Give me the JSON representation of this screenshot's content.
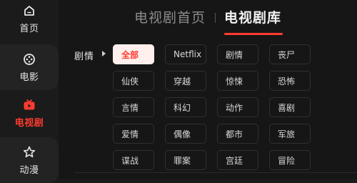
{
  "sidebar": {
    "items": [
      {
        "label": "首页",
        "icon": "home-icon"
      },
      {
        "label": "电影",
        "icon": "film-reel-icon"
      },
      {
        "label": "电视剧",
        "icon": "tv-icon",
        "active": true
      },
      {
        "label": "动漫",
        "icon": "star-icon"
      }
    ]
  },
  "tabs": [
    {
      "label": "电视剧首页"
    },
    {
      "label": "电视剧库",
      "active": true
    }
  ],
  "filter": {
    "label": "剧情",
    "options": [
      "全部",
      "Netflix",
      "剧情",
      "丧尸",
      "仙侠",
      "穿越",
      "惊悚",
      "恐怖",
      "言情",
      "科幻",
      "动作",
      "喜剧",
      "爱情",
      "偶像",
      "都市",
      "军旅",
      "谍战",
      "罪案",
      "宫廷",
      "冒险"
    ],
    "selected": "全部"
  },
  "colors": {
    "accent": "#ff3b2f",
    "background": "#161616",
    "sidebar": "#1b1b1b",
    "chip_border": "#303030",
    "selected_chip_bg": "#fff0ed"
  }
}
